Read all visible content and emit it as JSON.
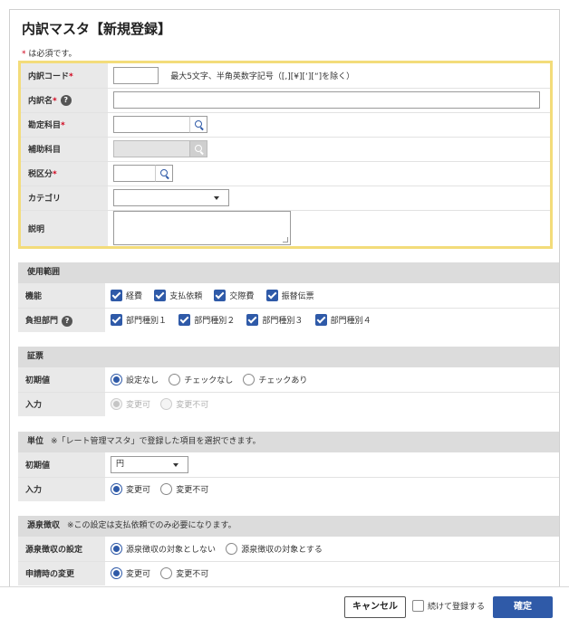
{
  "page": {
    "title": "内訳マスタ【新規登録】",
    "required_note": "は必須です。",
    "required_mark": "*"
  },
  "basic": {
    "code": {
      "label": "内訳コード",
      "value": "",
      "hint": "最大5文字、半角英数字記号（[,][¥][‘][“]を除く）"
    },
    "name": {
      "label": "内訳名",
      "value": "",
      "help": "?"
    },
    "account": {
      "label": "勘定科目",
      "value": ""
    },
    "sub_account": {
      "label": "補助科目",
      "value": ""
    },
    "tax": {
      "label": "税区分",
      "value": ""
    },
    "category": {
      "label": "カテゴリ",
      "value": ""
    },
    "description": {
      "label": "説明",
      "value": ""
    }
  },
  "usage": {
    "header": "使用範囲",
    "function": {
      "label": "機能",
      "options": [
        "経費",
        "支払依頼",
        "交際費",
        "振替伝票"
      ]
    },
    "dept": {
      "label": "負担部門",
      "help": "?",
      "options": [
        "部門種別１",
        "部門種別２",
        "部門種別３",
        "部門種別４"
      ]
    }
  },
  "receipt": {
    "header": "証票",
    "initial": {
      "label": "初期値",
      "options": [
        "設定なし",
        "チェックなし",
        "チェックあり"
      ],
      "selected": 0
    },
    "input": {
      "label": "入力",
      "options": [
        "変更可",
        "変更不可"
      ],
      "selected": 0
    }
  },
  "unit": {
    "header": "単位",
    "note": "※「レート管理マスタ」で登録した項目を選択できます。",
    "initial": {
      "label": "初期値",
      "value": "円"
    },
    "input": {
      "label": "入力",
      "options": [
        "変更可",
        "変更不可"
      ],
      "selected": 0
    }
  },
  "withholding": {
    "header": "源泉徴収",
    "note": "※この設定は支払依頼でのみ必要になります。",
    "setting": {
      "label": "源泉徴収の設定",
      "options": [
        "源泉徴収の対象としない",
        "源泉徴収の対象とする"
      ],
      "selected": 0
    },
    "change": {
      "label": "申請時の変更",
      "options": [
        "変更可",
        "変更不可"
      ],
      "selected": 0
    }
  },
  "footer": {
    "cancel": "キャンセル",
    "continue_label": "続けて登録する",
    "confirm": "確定"
  },
  "colors": {
    "accent": "#2f5aa8",
    "required": "#d0021b",
    "highlight": "#f3dc7a"
  }
}
